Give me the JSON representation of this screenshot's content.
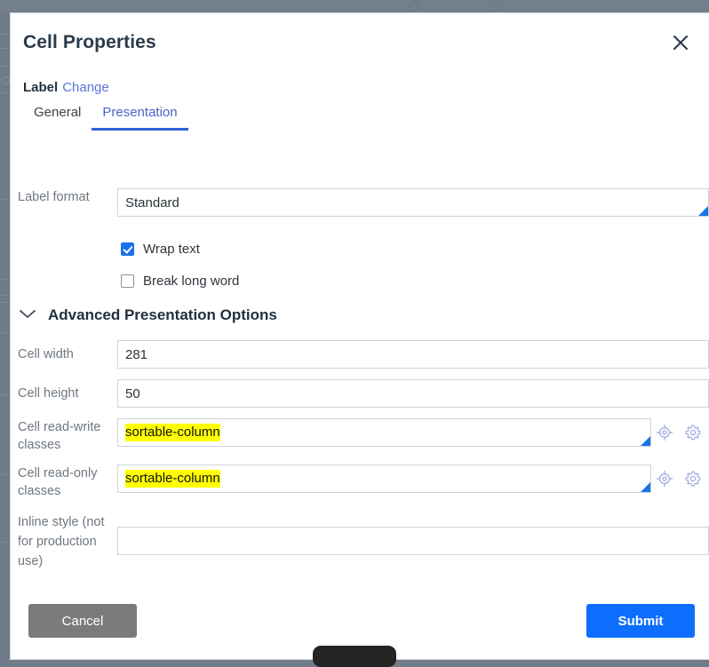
{
  "window": {
    "backdrop_color": "#707c87"
  },
  "dialog": {
    "title": "Cell Properties",
    "close_icon": "close-icon",
    "label_section": {
      "label": "Label",
      "change_link": "Change"
    },
    "tabs": [
      {
        "label": "General",
        "active": false
      },
      {
        "label": "Presentation",
        "active": true
      }
    ],
    "fields": {
      "label_format": {
        "label": "Label format",
        "value": "Standard",
        "placeholder": "",
        "has_resize_corner": true
      },
      "wrap_text": {
        "label": "Wrap text",
        "checked": true
      },
      "break_long_word": {
        "label": "Break long word",
        "checked": false
      },
      "advanced_section": {
        "title": "Advanced Presentation Options",
        "expanded": true,
        "chevron_icon": "chevron-down-icon"
      },
      "cell_width": {
        "label": "Cell width",
        "value": "281",
        "placeholder": ""
      },
      "cell_height": {
        "label": "Cell height",
        "value": "50",
        "placeholder": ""
      },
      "cell_read_write_classes": {
        "label": "Cell read-write classes",
        "value": "sortable-column",
        "highlight_color": "#ffff00",
        "has_resize_corner": true,
        "icons": [
          "target-icon",
          "gear-icon"
        ]
      },
      "cell_read_only_classes": {
        "label": "Cell read-only classes",
        "value": "sortable-column",
        "highlight_color": "#ffff00",
        "has_resize_corner": true,
        "icons": [
          "target-icon",
          "gear-icon"
        ]
      },
      "inline_style": {
        "label": "Inline style (not for production use)",
        "value": "",
        "placeholder": ""
      }
    },
    "footer": {
      "cancel_label": "Cancel",
      "submit_label": "Submit",
      "cancel_color": "#7b7b7b",
      "submit_color": "#0d6efd"
    }
  },
  "accent_colors": {
    "primary_blue": "#0d6efd",
    "tab_active": "#2f62d8",
    "link_blue": "#5b76d8",
    "highlight_yellow": "#ffff00",
    "icon_lavender": "#9aa6e0"
  }
}
